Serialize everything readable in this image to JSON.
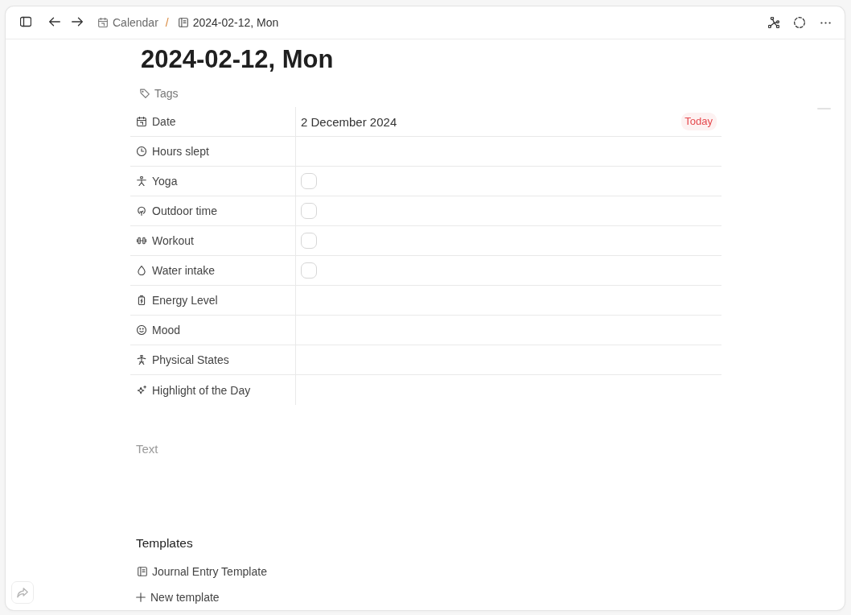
{
  "toolbar": {
    "breadcrumbs": [
      {
        "kind": "calendar",
        "label": "Calendar",
        "current": false
      },
      {
        "kind": "page",
        "label": "2024-02-12, Mon",
        "current": true
      }
    ],
    "separator": "/"
  },
  "page": {
    "title": "2024-02-12, Mon",
    "tags_label": "Tags",
    "properties": [
      {
        "kind": "date",
        "label": "Date",
        "value": "2 December 2024",
        "badge": "Today"
      },
      {
        "kind": "text",
        "label": "Hours slept"
      },
      {
        "kind": "checkbox",
        "label": "Yoga",
        "checked": false
      },
      {
        "kind": "checkbox",
        "label": "Outdoor time",
        "checked": false
      },
      {
        "kind": "checkbox",
        "label": "Workout",
        "checked": false
      },
      {
        "kind": "checkbox",
        "label": "Water intake",
        "checked": false
      },
      {
        "kind": "text",
        "label": "Energy Level"
      },
      {
        "kind": "text",
        "label": "Mood"
      },
      {
        "kind": "text",
        "label": "Physical States"
      },
      {
        "kind": "text",
        "label": "Highlight of the Day"
      }
    ],
    "editor": {
      "placeholder": "Text"
    }
  },
  "templates": {
    "heading": "Templates",
    "items": [
      {
        "label": "Journal Entry Template"
      }
    ],
    "new_button": "New template"
  }
}
